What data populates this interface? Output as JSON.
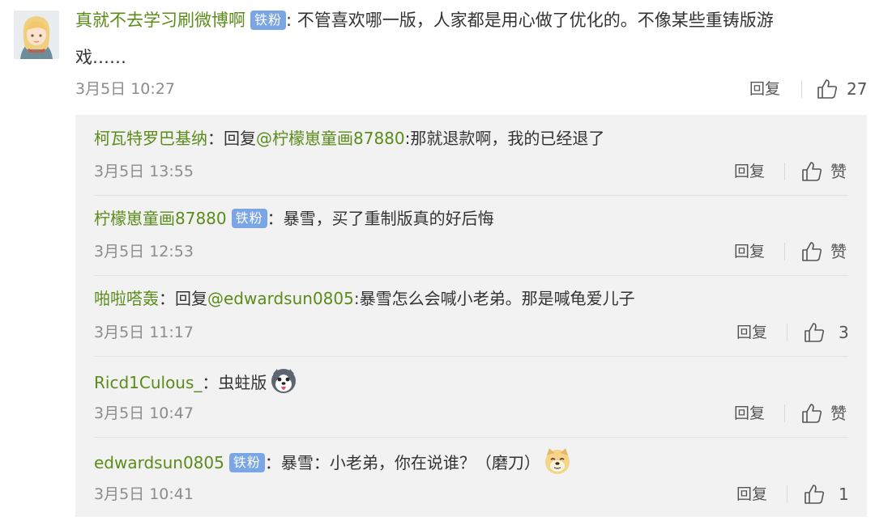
{
  "main_comment": {
    "username": "真就不去学习刷微博啊",
    "badge": "铁粉",
    "separator": ": ",
    "text_line1": "不管喜欢哪一版，人家都是用心做了优化的。不像某些重铸版游",
    "text_line2": "戏……",
    "date": "3月5日 10:27",
    "reply_label": "回复",
    "likes": "27"
  },
  "replies": [
    {
      "username": "柯瓦特罗巴基纳",
      "badge": "",
      "separator": "：",
      "prefix": "回复",
      "mention": "@柠檬崽童画87880",
      "text": ":那就退款啊，我的已经退了",
      "date": "3月5日 13:55",
      "reply_label": "回复",
      "likes": "赞"
    },
    {
      "username": "柠檬崽童画87880",
      "badge": "铁粉",
      "separator": "：",
      "prefix": "",
      "mention": "",
      "text": "暴雪，买了重制版真的好后悔",
      "date": "3月5日 12:53",
      "reply_label": "回复",
      "likes": "赞"
    },
    {
      "username": "啪啦嗒轰",
      "badge": "",
      "separator": "：",
      "prefix": "回复",
      "mention": "@edwardsun0805",
      "text": ":暴雪怎么会喊小老弟。那是喊龟爱儿子",
      "date": "3月5日 11:17",
      "reply_label": "回复",
      "likes": "3"
    },
    {
      "username": "Ricd1Culous_",
      "badge": "",
      "separator": "：",
      "prefix": "",
      "mention": "",
      "text": "虫蛀版",
      "emoji": "husky-emoji",
      "date": "3月5日 10:47",
      "reply_label": "回复",
      "likes": "赞"
    },
    {
      "username": "edwardsun0805",
      "badge": "铁粉",
      "separator": "：",
      "prefix": "",
      "mention": "",
      "text": "暴雪：小老弟，你在说谁？（磨刀）",
      "emoji": "doge-emoji",
      "date": "3月5日 10:41",
      "reply_label": "回复",
      "likes": "1"
    }
  ],
  "colors": {
    "username": "#5b8c1a",
    "badge_bg": "#7aa6e6",
    "reply_bg": "#f2f2f2",
    "date": "#8c8c8c"
  }
}
